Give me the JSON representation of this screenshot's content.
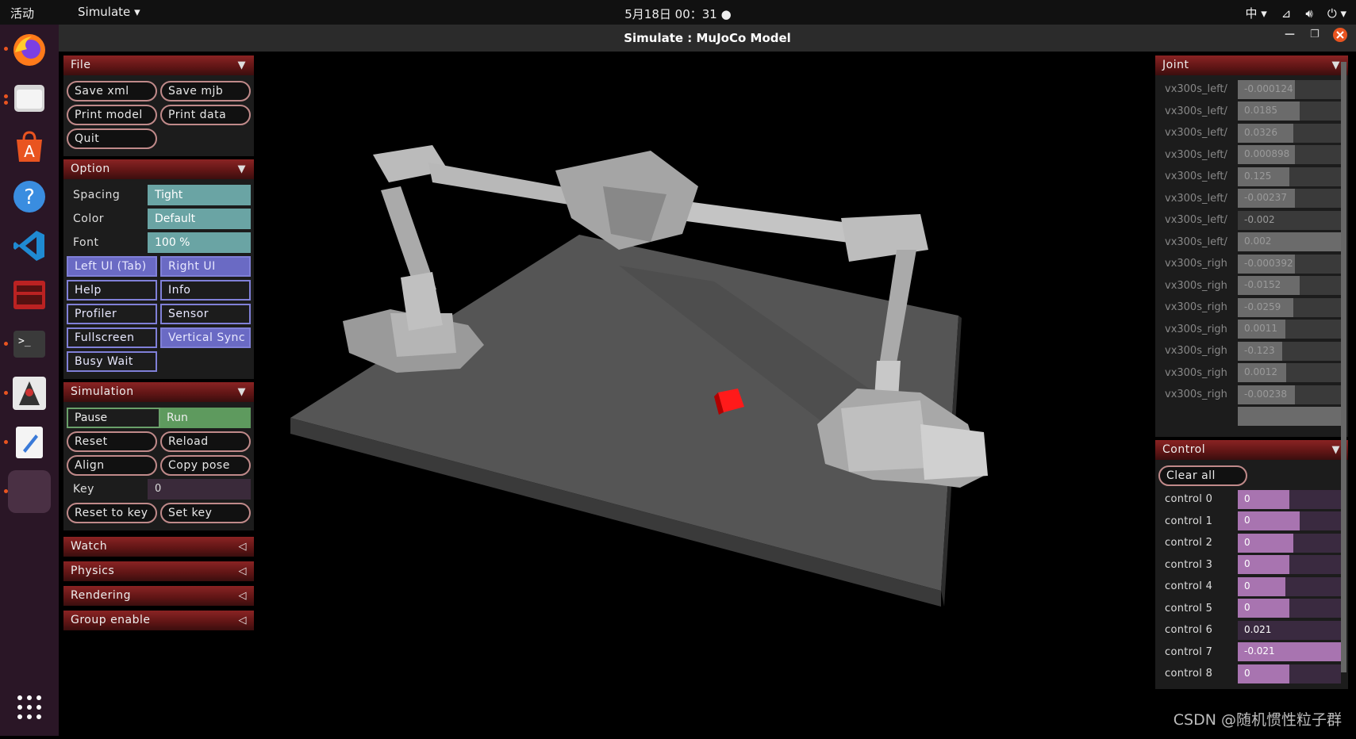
{
  "topbar": {
    "activities": "活动",
    "app_menu": "Simulate",
    "clock": "5月18日  00：31",
    "ime": "中"
  },
  "window": {
    "title": "Simulate : MuJoCo Model"
  },
  "left": {
    "file": {
      "header": "File",
      "buttons": [
        "Save xml",
        "Save mjb",
        "Print model",
        "Print data",
        "Quit"
      ]
    },
    "option": {
      "header": "Option",
      "spacing_label": "Spacing",
      "spacing_value": "Tight",
      "color_label": "Color",
      "color_value": "Default",
      "font_label": "Font",
      "font_value": "100 %",
      "toggles": [
        "Left UI (Tab)",
        "Right UI",
        "Help",
        "Info",
        "Profiler",
        "Sensor",
        "Fullscreen",
        "Vertical Sync",
        "Busy Wait"
      ]
    },
    "simulation": {
      "header": "Simulation",
      "pause": "Pause",
      "run": "Run",
      "reset": "Reset",
      "reload": "Reload",
      "align": "Align",
      "copy_pose": "Copy pose",
      "key_label": "Key",
      "key_value": "0",
      "reset_to_key": "Reset to key",
      "set_key": "Set key"
    },
    "collapsed": [
      "Watch",
      "Physics",
      "Rendering",
      "Group enable"
    ]
  },
  "right": {
    "joint": {
      "header": "Joint",
      "rows": [
        {
          "label": "vx300s_left/",
          "value": "-0.000124",
          "fill": 0.55
        },
        {
          "label": "vx300s_left/",
          "value": "0.0185",
          "fill": 0.6
        },
        {
          "label": "vx300s_left/",
          "value": "0.0326",
          "fill": 0.54
        },
        {
          "label": "vx300s_left/",
          "value": "0.000898",
          "fill": 0.55
        },
        {
          "label": "vx300s_left/",
          "value": "0.125",
          "fill": 0.5
        },
        {
          "label": "vx300s_left/",
          "value": "-0.00237",
          "fill": 0.55
        },
        {
          "label": "vx300s_left/",
          "value": "-0.002",
          "fill": 0.0
        },
        {
          "label": "vx300s_left/",
          "value": "0.002",
          "fill": 1.0
        },
        {
          "label": "vx300s_righ",
          "value": "-0.000392",
          "fill": 0.55
        },
        {
          "label": "vx300s_righ",
          "value": "-0.0152",
          "fill": 0.6
        },
        {
          "label": "vx300s_righ",
          "value": "-0.0259",
          "fill": 0.54
        },
        {
          "label": "vx300s_righ",
          "value": "0.0011",
          "fill": 0.46
        },
        {
          "label": "vx300s_righ",
          "value": "-0.123",
          "fill": 0.43
        },
        {
          "label": "vx300s_righ",
          "value": "0.0012",
          "fill": 0.47
        },
        {
          "label": "vx300s_righ",
          "value": "-0.00238",
          "fill": 0.55
        },
        {
          "label": "",
          "value": "",
          "fill": 1.0
        }
      ]
    },
    "control": {
      "header": "Control",
      "clear_all": "Clear all",
      "rows": [
        {
          "label": "control 0",
          "value": "0",
          "fill": 0.5
        },
        {
          "label": "control 1",
          "value": "0",
          "fill": 0.6
        },
        {
          "label": "control 2",
          "value": "0",
          "fill": 0.54
        },
        {
          "label": "control 3",
          "value": "0",
          "fill": 0.5
        },
        {
          "label": "control 4",
          "value": "0",
          "fill": 0.46
        },
        {
          "label": "control 5",
          "value": "0",
          "fill": 0.5
        },
        {
          "label": "control 6",
          "value": "0.021",
          "fill": 0.0
        },
        {
          "label": "control 7",
          "value": "-0.021",
          "fill": 1.0
        },
        {
          "label": "control 8",
          "value": "0",
          "fill": 0.5
        }
      ]
    }
  },
  "watermark": "CSDN @随机惯性粒子群"
}
